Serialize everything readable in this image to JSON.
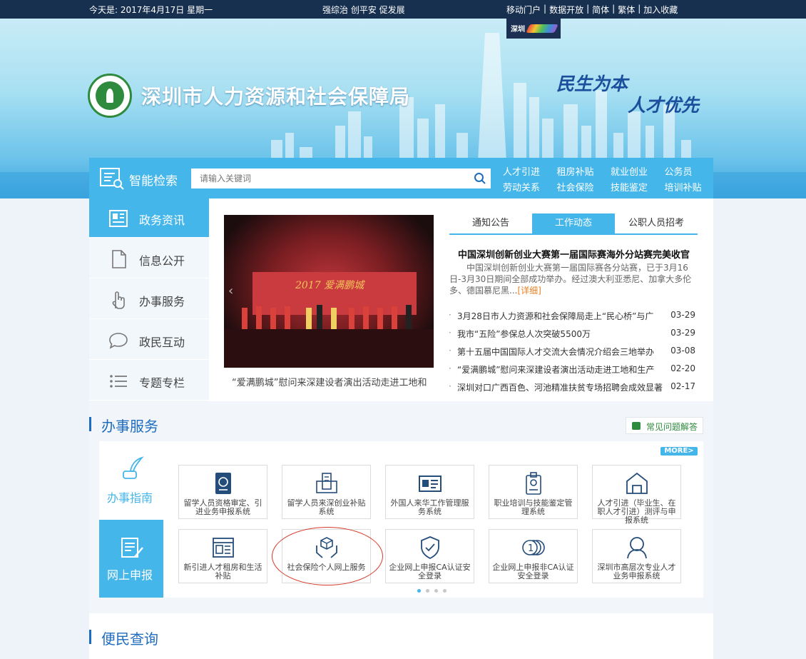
{
  "topbar": {
    "date": "今天是: 2017年4月17日  星期一",
    "slogan": "强综治 创平安 促发展",
    "links": [
      "移动门户",
      "数据开放",
      "简体",
      "繁体",
      "加入收藏"
    ]
  },
  "banner": {
    "site_title": "深圳市人力资源和社会保障局",
    "motto_1": "民生为本",
    "motto_2": "人才优先",
    "emblem_icon": "hrss-emblem-icon",
    "city_logo_icon": "shenzhen-city-logo-icon"
  },
  "search": {
    "label": "智能检索",
    "placeholder": "请输入关键词",
    "quick_links": [
      "人才引进",
      "租房补贴",
      "就业创业",
      "公务员",
      "劳动关系",
      "社会保险",
      "技能鉴定",
      "培训补贴"
    ]
  },
  "leftnav": {
    "items": [
      {
        "label": "政务资讯",
        "icon": "newspaper-icon",
        "active": true
      },
      {
        "label": "信息公开",
        "icon": "document-icon",
        "active": false
      },
      {
        "label": "办事服务",
        "icon": "hand-pointer-icon",
        "active": false
      },
      {
        "label": "政民互动",
        "icon": "chat-bubble-icon",
        "active": false
      },
      {
        "label": "专题专栏",
        "icon": "list-icon",
        "active": false
      }
    ]
  },
  "featured": {
    "photo_banner_text": "2017 爱满鹏城",
    "caption": "“爱满鹏城”慰问来深建设者演出活动走进工地和"
  },
  "news": {
    "tabs": [
      "通知公告",
      "工作动态",
      "公职人员招考"
    ],
    "active_tab": 1,
    "headline": "中国深圳创新创业大赛第一届国际赛海外分站赛完美收官",
    "summary": "中国深圳创新创业大赛第一届国际赛各分站赛，已于3月16日-3月30日期间全部成功举办。经过澳大利亚悉尼、加拿大多伦多、德国慕尼黑...",
    "detail_link": "[详细]",
    "items": [
      {
        "title": "3月28日市人力资源和社会保障局走上“民心桥”与广",
        "date": "03-29"
      },
      {
        "title": "我市“五险”参保总人次突破5500万",
        "date": "03-29"
      },
      {
        "title": "第十五届中国国际人才交流大会情况介绍会三地举办",
        "date": "03-08"
      },
      {
        "title": "“爱满鹏城”慰问来深建设者演出活动走进工地和生产",
        "date": "02-20"
      },
      {
        "title": "深圳对口广西百色、河池精准扶贫专场招聘会成效显著",
        "date": "02-17"
      }
    ]
  },
  "services": {
    "title": "办事服务",
    "faq": "常见问题解答",
    "guide_label": "办事指南",
    "apply_label": "网上申报",
    "more": "MORE>",
    "cards": [
      {
        "label": "留学人员资格审定、引进业务申报系统",
        "icon": "passport-icon"
      },
      {
        "label": "留学人员来深创业补贴系统",
        "icon": "computer-building-icon"
      },
      {
        "label": "外国人来华工作管理服务系统",
        "icon": "id-card-icon"
      },
      {
        "label": "职业培训与技能鉴定管理系统",
        "icon": "badge-icon"
      },
      {
        "label": "人才引进（毕业生、在职人才引进）测评与申报系统",
        "icon": "house-icon"
      },
      {
        "label": "新引进人才租房和生活补贴",
        "icon": "newspaper-icon"
      },
      {
        "label": "社会保险个人网上服务",
        "icon": "hands-box-icon"
      },
      {
        "label": "企业网上申报CA认证安全登录",
        "icon": "shield-check-icon"
      },
      {
        "label": "企业网上申报非CA认证安全登录",
        "icon": "coins-icon"
      },
      {
        "label": "深圳市高层次专业人才业务申报系统",
        "icon": "person-icon"
      }
    ],
    "active_page": 0,
    "page_count": 4
  },
  "query": {
    "title": "便民查询"
  },
  "colors": {
    "accent": "#45b6ea",
    "topbar": "#18304f",
    "heading": "#1e6cbf",
    "highlight": "#d93a2b"
  }
}
